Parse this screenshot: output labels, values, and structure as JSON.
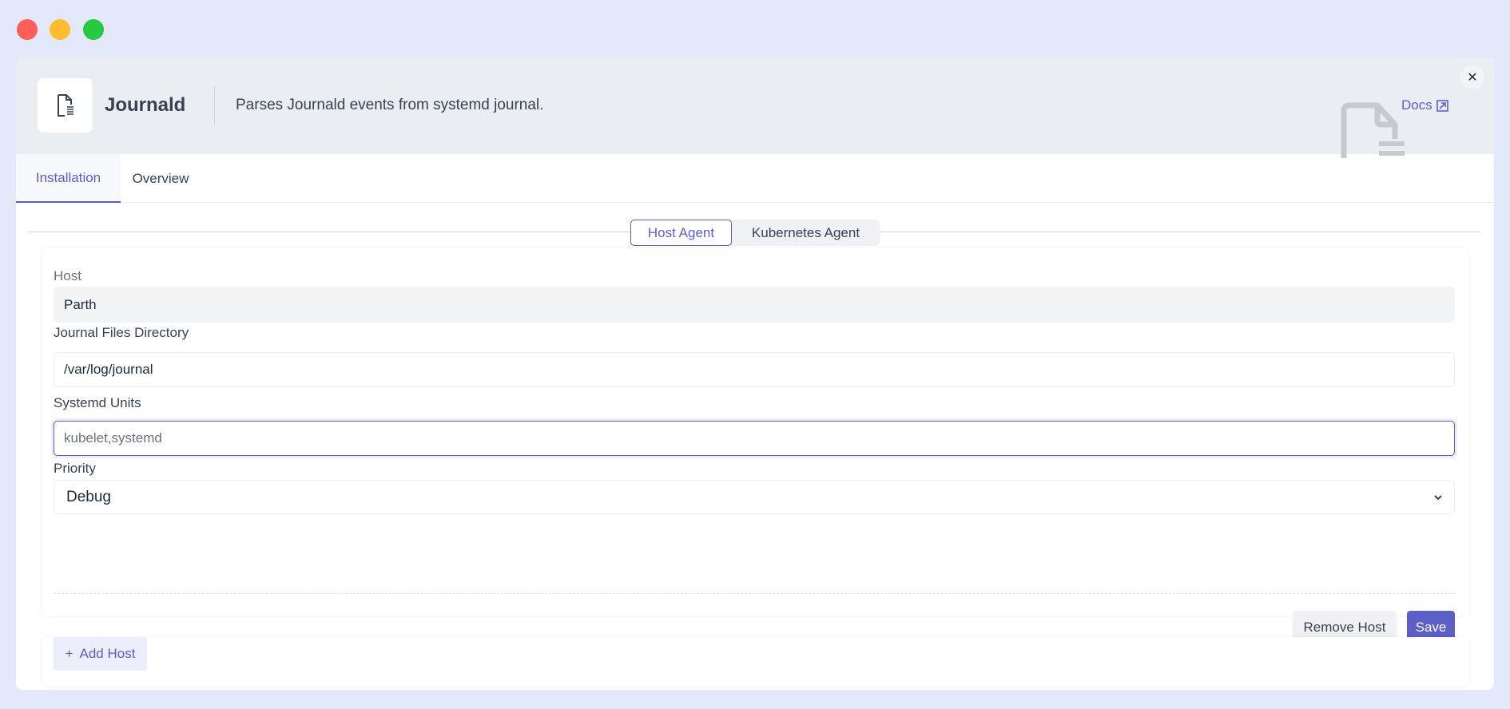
{
  "window": {
    "controls": {
      "close_color": "#ff5f57",
      "minimize_color": "#febc2e",
      "zoom_color": "#28c840"
    }
  },
  "header": {
    "title": "Journald",
    "description": "Parses Journald events from systemd journal.",
    "docs_label": "Docs",
    "icon": "file-text-icon"
  },
  "tabs": [
    {
      "label": "Installation",
      "active": true
    },
    {
      "label": "Overview",
      "active": false
    }
  ],
  "agent_toggle": [
    {
      "label": "Host Agent",
      "active": true
    },
    {
      "label": "Kubernetes Agent",
      "active": false
    }
  ],
  "form": {
    "host": {
      "label": "Host",
      "value": "Parth"
    },
    "journal_dir": {
      "label": "Journal Files Directory",
      "value": "/var/log/journal"
    },
    "systemd_units": {
      "label": "Systemd Units",
      "placeholder": "kubelet,systemd"
    },
    "priority": {
      "label": "Priority",
      "value": "Debug"
    },
    "remove_label": "Remove Host",
    "save_label": "Save"
  },
  "add_host_label": "Add Host",
  "colors": {
    "accent": "#5b5fc7",
    "background": "#e3e9fb",
    "header": "#eaeef3"
  }
}
